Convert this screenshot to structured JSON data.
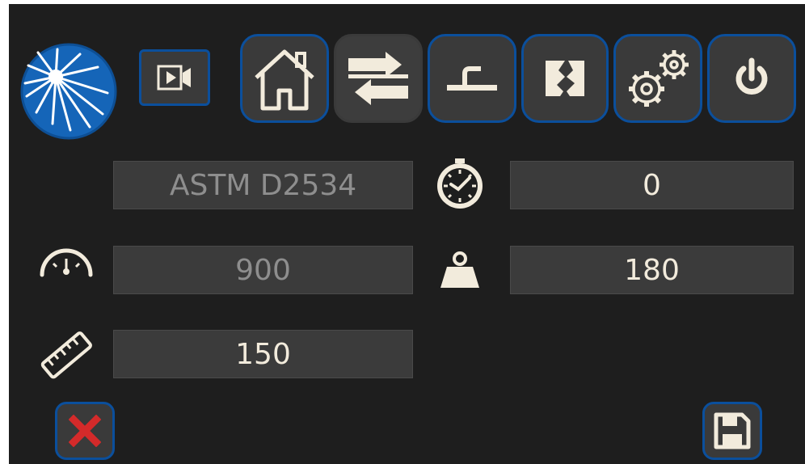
{
  "toolbar": {
    "logo_icon": "burst-logo-icon",
    "video_icon": "video-camera-icon",
    "buttons": [
      {
        "name": "home",
        "icon": "home-icon"
      },
      {
        "name": "swap",
        "icon": "swap-arrows-icon",
        "active": true
      },
      {
        "name": "probe",
        "icon": "probe-tool-icon"
      },
      {
        "name": "fracture",
        "icon": "crack-icon"
      },
      {
        "name": "settings",
        "icon": "gears-icon"
      },
      {
        "name": "power",
        "icon": "power-icon"
      }
    ]
  },
  "form": {
    "standard": "ASTM D2534",
    "time": "0",
    "speed": "900",
    "load": "180",
    "length": "150"
  },
  "colors": {
    "accent": "#0b4f9c",
    "background": "#1e1e1e",
    "field": "#3b3b3b",
    "icon": "#f2ebdc",
    "cancel": "#d42a2a"
  }
}
